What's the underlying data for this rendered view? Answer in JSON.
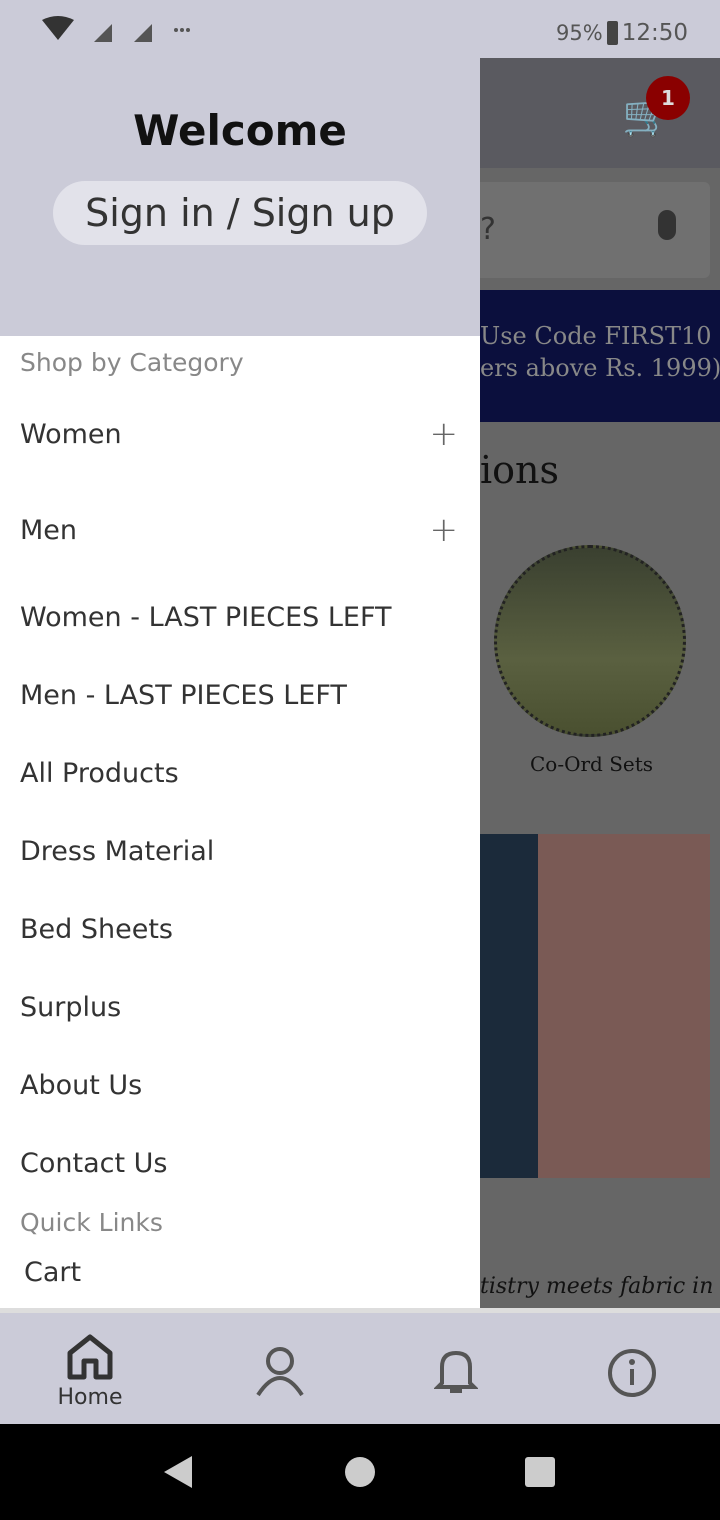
{
  "status": {
    "battery": "95%",
    "time": "12:50"
  },
  "drawer": {
    "welcome": "Welcome",
    "signin": "Sign in / Sign up",
    "section1": "Shop by Category",
    "items": [
      {
        "label": "Women",
        "expand": true
      },
      {
        "label": "Men",
        "expand": true
      },
      {
        "label": "Women - LAST PIECES LEFT"
      },
      {
        "label": "Men - LAST PIECES LEFT"
      },
      {
        "label": "All Products"
      },
      {
        "label": "Dress Material"
      },
      {
        "label": "Bed Sheets"
      },
      {
        "label": "Surplus"
      },
      {
        "label": "About Us"
      },
      {
        "label": "Contact Us"
      }
    ],
    "section2": "Quick Links",
    "quick": [
      "Cart"
    ]
  },
  "background": {
    "cart_count": "1",
    "search_partial": "?",
    "promo_line1": "Use Code FIRST10",
    "promo_line2": "ers above Rs. 1999)",
    "heading_partial": "ions",
    "collection_label": "Co-Ord Sets",
    "tagline_partial": "tistry meets fabric in"
  },
  "bottom_nav": {
    "home": "Home"
  },
  "colors": {
    "accent_badge": "#b00000",
    "promo_bg": "#0b0f3d"
  }
}
